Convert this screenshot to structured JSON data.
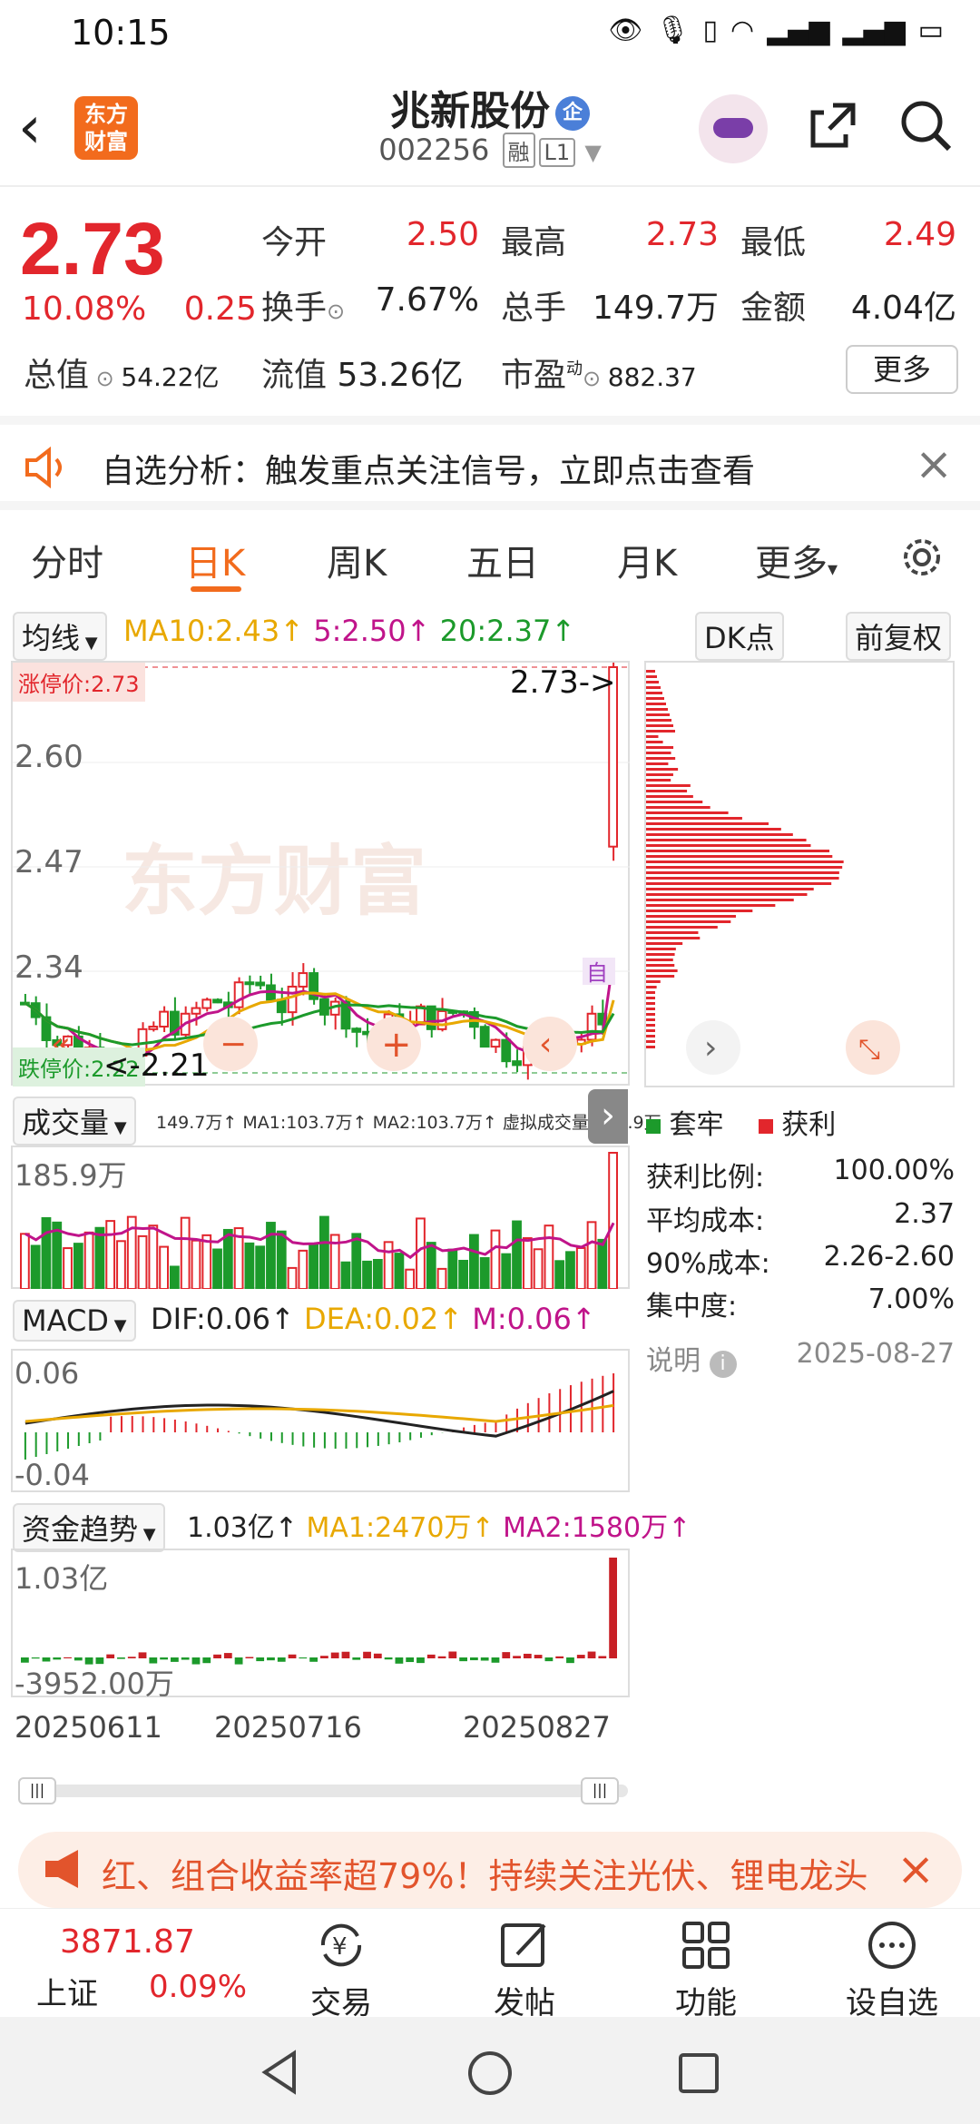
{
  "status_bar": {
    "time": "10:15",
    "icons": [
      "eye-icon",
      "mic-icon",
      "vibrate-icon",
      "wifi-icon",
      "signal-4g-icon",
      "signal-4g-icon",
      "battery-icon"
    ]
  },
  "header": {
    "logo_text": "东方财富",
    "stock_name": "兆新股份",
    "badge": "企",
    "stock_code": "002256",
    "tag_rong": "融",
    "tag_level": "L1"
  },
  "quote": {
    "price": "2.73",
    "change_pct": "10.08%",
    "change_abs": "0.25",
    "rows": [
      [
        {
          "label": "今开",
          "value": "2.50",
          "color": "red"
        },
        {
          "label": "最高",
          "value": "2.73",
          "color": "red"
        },
        {
          "label": "最低",
          "value": "2.49",
          "color": "red"
        }
      ],
      [
        {
          "label": "换手",
          "value": "7.67%",
          "color": "black"
        },
        {
          "label": "总手",
          "value": "149.7万",
          "color": "black"
        },
        {
          "label": "金额",
          "value": "4.04亿",
          "color": "black"
        }
      ],
      [
        {
          "label": "总值",
          "value": "54.22亿"
        },
        {
          "label": "流值",
          "value": "53.26亿"
        },
        {
          "label": "市盈",
          "sup": "动",
          "value": "882.37"
        }
      ]
    ],
    "more_label": "更多"
  },
  "notice": {
    "text": "自选分析：触发重点关注信号，立即点击查看"
  },
  "tabs": {
    "items": [
      "分时",
      "日K",
      "周K",
      "五日",
      "月K",
      "更多"
    ],
    "active": "日K"
  },
  "indicator_bar": {
    "ma_select": "均线",
    "ma10": "MA10:2.43",
    "ma5": "5:2.50",
    "ma20": "20:2.37",
    "arrow": "↑",
    "dk_label": "DK点",
    "adjust_label": "前复权"
  },
  "kline": {
    "limit_up_label": "涨停价:2.73",
    "limit_down_label": "跌停价:2.22",
    "current_label": "2.73->",
    "low_label": "<-2.21",
    "y_ticks": [
      "2.60",
      "2.47",
      "2.34",
      "2.21"
    ],
    "watermark": "东方财富",
    "auto_label": "自"
  },
  "volume": {
    "select": "成交量",
    "legend": "149.7万↑ MA1:103.7万↑ MA2:103.7万↑ 虚拟成交量:185.9万",
    "max_label": "185.9万"
  },
  "macd": {
    "select": "MACD",
    "dif": "DIF:0.06↑",
    "dea": "DEA:0.02↑",
    "m": "M:0.06↑",
    "top_label": "0.06",
    "bottom_label": "-0.04"
  },
  "fund": {
    "select": "资金趋势",
    "val": "1.03亿↑",
    "ma1": "MA1:2470万↑",
    "ma2": "MA2:1580万↑",
    "top_label": "1.03亿",
    "bottom_label": "-3952.00万"
  },
  "dates": [
    "20250611",
    "20250716",
    "20250827"
  ],
  "chips": {
    "legend_hold": "套牢",
    "legend_profit": "获利",
    "rows": [
      {
        "label": "获利比例:",
        "value": "100.00%"
      },
      {
        "label": "平均成本:",
        "value": "2.37"
      },
      {
        "label": "90%成本:",
        "value": "2.26-2.60"
      },
      {
        "label": "集中度:",
        "value": "7.00%"
      }
    ],
    "note_label": "说明",
    "date": "2025-08-27"
  },
  "banner": {
    "text": "红、组合收益率超79%！持续关注光伏、锂电龙头"
  },
  "bottom_nav": {
    "index_value": "3871.87",
    "index_name": "上证",
    "index_change": "0.09%",
    "items": [
      "交易",
      "发帖",
      "功能",
      "设自选"
    ]
  },
  "colors": {
    "accent": "#f26b1d",
    "up": "#e2262c",
    "down": "#1c9a2b"
  }
}
